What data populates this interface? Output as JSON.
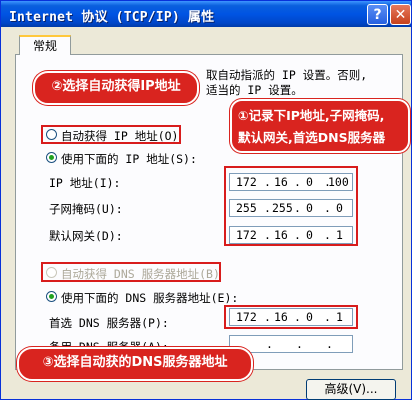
{
  "window": {
    "title": "Internet 协议 (TCP/IP) 属性",
    "help_btn": "?",
    "close_btn": "X"
  },
  "tab": {
    "label": "常规"
  },
  "description": {
    "line1": "取自动指派的 IP 设置。否则,",
    "line2": "适当的 IP 设置。"
  },
  "ip_section": {
    "auto_option": "自动获得 IP 地址(O)",
    "manual_option": "使用下面的 IP 地址(S):",
    "ip_label": "IP 地址(I):",
    "mask_label": "子网掩码(U):",
    "gateway_label": "默认网关(D):",
    "ip_value": [
      "172",
      "16",
      "0",
      "100"
    ],
    "mask_value": [
      "255",
      "255",
      "0",
      "0"
    ],
    "gateway_value": [
      "172",
      "16",
      "0",
      "1"
    ]
  },
  "dns_section": {
    "auto_option": "自动获得 DNS 服务器地址(B)",
    "manual_option": "使用下面的 DNS 服务器地址(E):",
    "preferred_label": "首选 DNS 服务器(P):",
    "alternate_label": "备用 DNS 服务器(A):",
    "preferred_value": [
      "172",
      "16",
      "0",
      "1"
    ],
    "alternate_value": [
      ".",
      ".",
      "."
    ]
  },
  "callouts": {
    "step2": "②选择自动获得IP地址",
    "step1_line1": "①记录下IP地址,子网掩码,",
    "step1_line2": "默认网关,首选DNS服务器",
    "step3": "③选择自动获的DNS服务器地址"
  },
  "buttons": {
    "advanced": "高级(V)..."
  },
  "colors": {
    "callout_red": "#d9241f",
    "title_blue": "#0054e3",
    "radio_green": "#21a121"
  }
}
